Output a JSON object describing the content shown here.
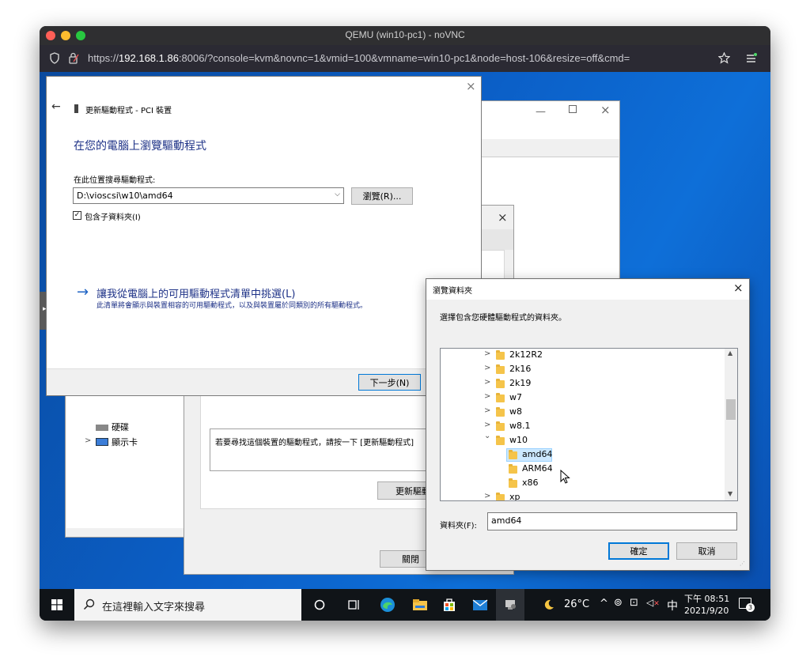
{
  "mac": {
    "title": "QEMU (win10-pc1) - noVNC",
    "url_prefix": "https://",
    "url_host": "192.168.1.86",
    "url_rest": ":8006/?console=kvm&novnc=1&vmid=100&vmname=win10-pc1&node=host-106&resize=off&cmd=",
    "colors": {
      "close": "#ff5f57",
      "minimize": "#febc2e",
      "zoom": "#28c840"
    }
  },
  "wizard": {
    "header": "更新驅動程式 - PCI 裝置",
    "heading": "在您的電腦上瀏覽驅動程式",
    "search_label": "在此位置搜尋驅動程式:",
    "path_value": "D:\\vioscsi\\w10\\amd64",
    "browse_button": "瀏覽(R)...",
    "include_subfolders": "包含子資料夾(I)",
    "pick_title": "讓我從電腦上的可用驅動程式清單中挑選(L)",
    "pick_desc": "此清單將會顯示與裝置相容的可用驅動程式，以及與裝置屬於同類別的所有驅動程式。",
    "next_button": "下一步(N)",
    "arrow": "→"
  },
  "background": {
    "device_items": [
      "硬碟",
      "顯示卡"
    ],
    "message": "若要尋找這個裝置的驅動程式，請按一下 [更新驅動程式]",
    "update_button": "更新驅動",
    "close_button": "關閉"
  },
  "browse_dialog": {
    "title": "瀏覽資料夾",
    "instruction": "選擇包含您硬體驅動程式的資料夾。",
    "tree": [
      {
        "label": "2k12R2",
        "level": 0,
        "chevron": ">"
      },
      {
        "label": "2k16",
        "level": 0,
        "chevron": ">"
      },
      {
        "label": "2k19",
        "level": 0,
        "chevron": ">"
      },
      {
        "label": "w7",
        "level": 0,
        "chevron": ">"
      },
      {
        "label": "w8",
        "level": 0,
        "chevron": ">"
      },
      {
        "label": "w8.1",
        "level": 0,
        "chevron": ">"
      },
      {
        "label": "w10",
        "level": 0,
        "chevron": "v"
      },
      {
        "label": "amd64",
        "level": 1,
        "chevron": "",
        "selected": true
      },
      {
        "label": "ARM64",
        "level": 1,
        "chevron": ""
      },
      {
        "label": "x86",
        "level": 1,
        "chevron": ""
      },
      {
        "label": "xp",
        "level": 0,
        "chevron": ">"
      }
    ],
    "folder_label": "資料夾(F):",
    "folder_value": "amd64",
    "ok_button": "確定",
    "cancel_button": "取消"
  },
  "taskbar": {
    "search_placeholder": "在這裡輸入文字來搜尋",
    "weather": "26°C",
    "ime": "中",
    "time": "下午 08:51",
    "date": "2021/9/20",
    "notification_count": "3"
  }
}
